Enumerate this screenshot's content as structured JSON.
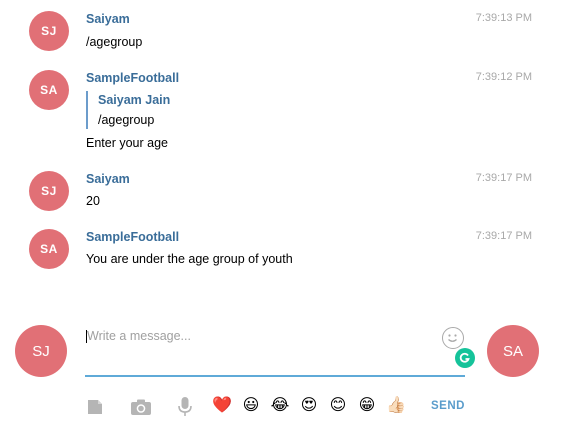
{
  "messages": [
    {
      "avatar": "SJ",
      "sender": "Saiyam",
      "time": "7:39:13 PM",
      "text": "/agegroup"
    },
    {
      "avatar": "SA",
      "sender": "SampleFootball",
      "time": "7:39:12 PM",
      "reply": {
        "name": "Saiyam Jain",
        "text": "/agegroup"
      },
      "text": "Enter your age"
    },
    {
      "avatar": "SJ",
      "sender": "Saiyam",
      "time": "7:39:17 PM",
      "text": "20"
    },
    {
      "avatar": "SA",
      "sender": "SampleFootball",
      "time": "7:39:17 PM",
      "text": "You are under the age group of youth"
    }
  ],
  "composer": {
    "my_avatar": "SJ",
    "peer_avatar": "SA",
    "placeholder": "Write a message...",
    "send_label": "SEND"
  },
  "toolbar": {
    "icons": [
      "attach-file-icon",
      "camera-icon",
      "microphone-icon"
    ],
    "emojis": [
      "❤️",
      "😃",
      "😂",
      "😍",
      "😊",
      "😁",
      "👍🏻"
    ]
  },
  "colors": {
    "avatar": "#e17076",
    "sender": "#3a6d99",
    "accent": "#5faad8",
    "time": "#a8a8a8"
  }
}
